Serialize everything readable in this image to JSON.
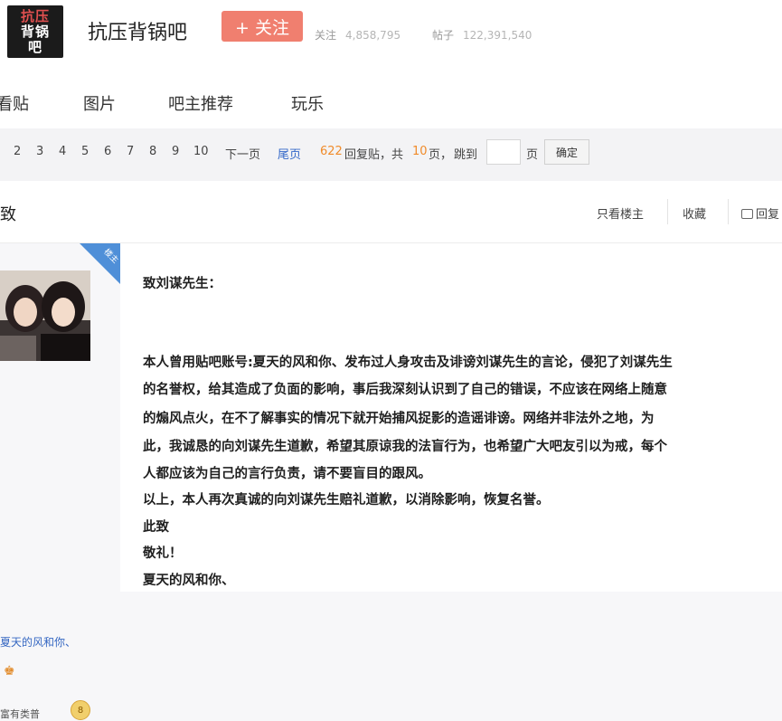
{
  "header": {
    "logo_line1": "抗压",
    "logo_line2": "背锅",
    "logo_line3": "吧",
    "forum_name": "抗压背锅吧",
    "follow_label": "+ 关注",
    "follow_count_label": "关注",
    "follow_count": "4,858,795",
    "post_count_label": "帖子",
    "post_count": "122,391,540"
  },
  "tabs": [
    "看贴",
    "图片",
    "吧主推荐",
    "玩乐"
  ],
  "pager": {
    "pages": [
      "2",
      "3",
      "4",
      "5",
      "6",
      "7",
      "8",
      "9",
      "10"
    ],
    "next": "下一页",
    "last": "尾页",
    "replies": "622",
    "replies_label": "回复贴，共",
    "total_pages": "10",
    "pages_unit": "页，",
    "jump_label": "跳到",
    "jump_unit": "页",
    "confirm": "确定"
  },
  "thread": {
    "title": "致",
    "only_owner": "只看楼主",
    "favorite": "收藏",
    "reply": "回复"
  },
  "post": {
    "corner_tag": "楼主",
    "user_name": "夏天的风和你、",
    "rank_label": "富有类普",
    "rank_level": "8",
    "lines": [
      "致刘谋先生：",
      "本人曾用贴吧账号:夏天的风和你、发布过人身攻击及诽谤刘谋先生的言论，侵犯了刘谋先生",
      "的名誉权，给其造成了负面的影响，事后我深刻认识到了自己的错误，不应该在网络上随意",
      "的煽风点火，在不了解事实的情况下就开始捕风捉影的造谣诽谤。网络并非法外之地，为",
      "此，我诚恳的向刘谋先生道歉，希望其原谅我的法盲行为，也希望广大吧友引以为戒，每个",
      "人都应该为自己的言行负责，请不要盲目的跟风。",
      "以上，本人再次真诚的向刘谋先生赔礼道歉，以消除影响，恢复名誉。",
      "此致",
      "敬礼！",
      "夏天的风和你、"
    ]
  },
  "colors": {
    "follow_button": "#f07f6f",
    "link_blue": "#3569c9",
    "reply_count_orange": "#f08b2a"
  }
}
